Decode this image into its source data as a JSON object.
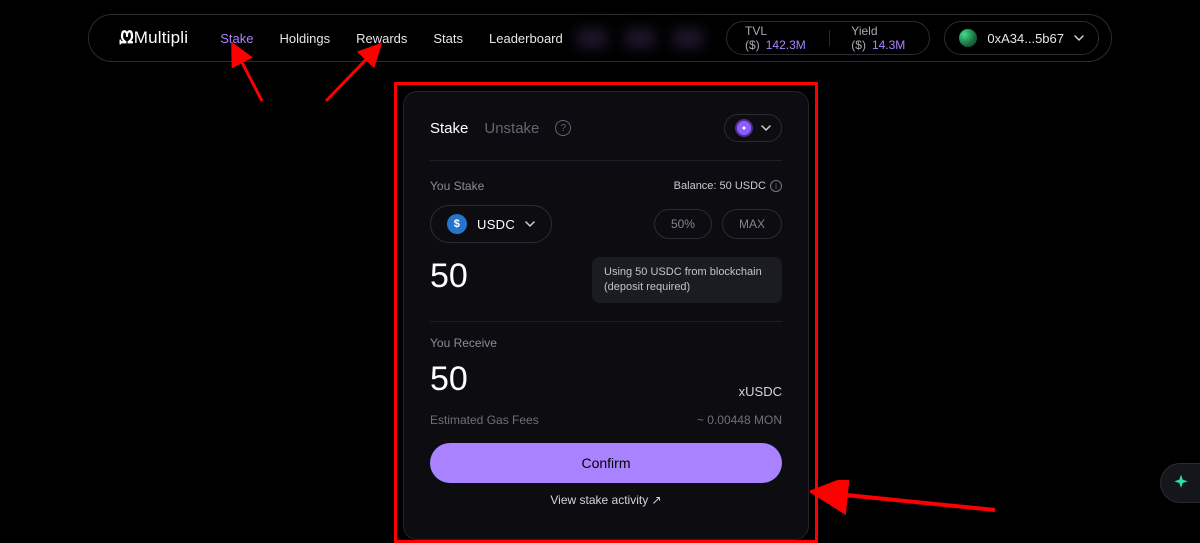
{
  "brand": "Multipli",
  "nav": {
    "stake": "Stake",
    "holdings": "Holdings",
    "rewards": "Rewards",
    "stats": "Stats",
    "leaderboard": "Leaderboard"
  },
  "stats": {
    "tvl_label": "TVL ($)",
    "tvl_value": "142.3M",
    "yield_label": "Yield ($)",
    "yield_value": "14.3M"
  },
  "wallet": {
    "address": "0xA34...5b67"
  },
  "card": {
    "tab_stake": "Stake",
    "tab_unstake": "Unstake",
    "you_stake_label": "You Stake",
    "balance_label": "Balance: 50 USDC",
    "asset_symbol": "USDC",
    "pct50": "50%",
    "pctmax": "MAX",
    "stake_amount": "50",
    "tooltip": "Using 50 USDC from blockchain (deposit required)",
    "you_receive_label": "You Receive",
    "receive_amount": "50",
    "receive_symbol": "xUSDC",
    "gas_label": "Estimated Gas Fees",
    "gas_value": "~ 0.00448 MON",
    "confirm": "Confirm",
    "activity": "View stake activity ↗"
  }
}
